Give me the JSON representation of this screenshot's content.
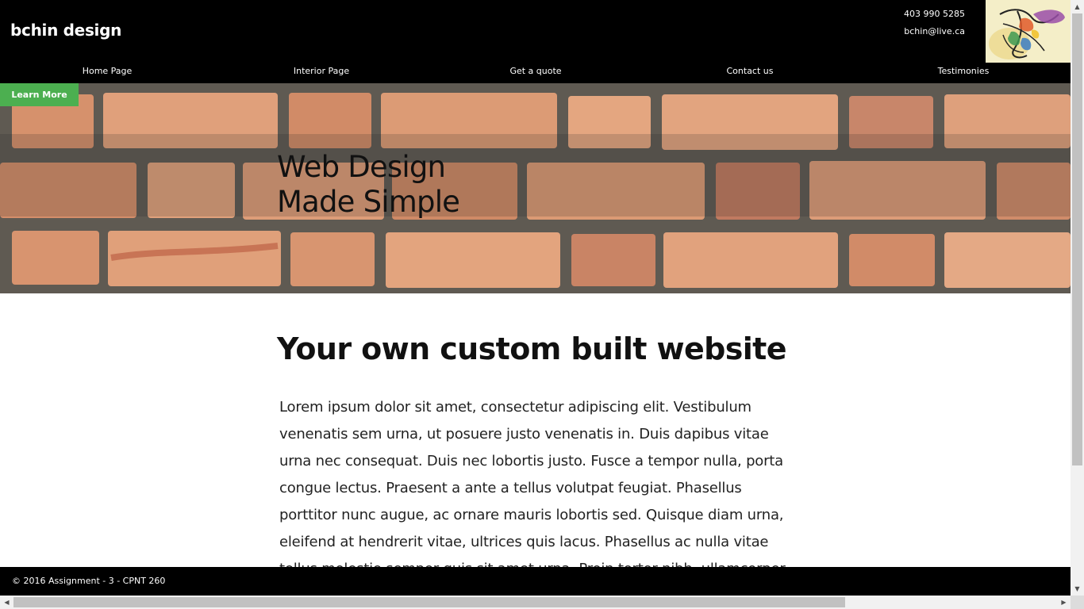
{
  "header": {
    "brand": "bchin design",
    "phone": "403 990 5285",
    "email": "bchin@live.ca"
  },
  "nav": {
    "items": [
      "Home Page",
      "Interior Page",
      "Get a quote",
      "Contact us",
      "Testimonies"
    ]
  },
  "hero": {
    "cta_label": "Learn More",
    "title_line1": "Web Design",
    "title_line2": "Made Simple"
  },
  "main": {
    "title": "Your own custom built website",
    "paragraph": "Lorem ipsum dolor sit amet, consectetur adipiscing elit. Vestibulum venenatis sem urna, ut posuere justo venenatis in. Duis dapibus vitae urna nec consequat. Duis nec lobortis justo. Fusce a tempor nulla, porta congue lectus. Praesent a ante a tellus volutpat feugiat. Phasellus porttitor nunc augue, ac ornare mauris lobortis sed. Quisque diam urna, eleifend at hendrerit vitae, ultrices quis lacus. Phasellus ac nulla vitae tellus molestie semper quis sit amet urna. Proin tortor nibh, ullamcorper et arcu feugiat."
  },
  "footer": {
    "text": "© 2016 Assignment - 3 - CPNT 260"
  },
  "colors": {
    "header_bg": "#000000",
    "accent_button": "#4caf50",
    "brick": "#d9926a",
    "mortar": "#5f5a52"
  },
  "icons": {
    "logo": "abstract-colorful-logo",
    "scroll_up": "arrow-up-icon",
    "scroll_down": "arrow-down-icon",
    "scroll_left": "arrow-left-icon",
    "scroll_right": "arrow-right-icon"
  }
}
